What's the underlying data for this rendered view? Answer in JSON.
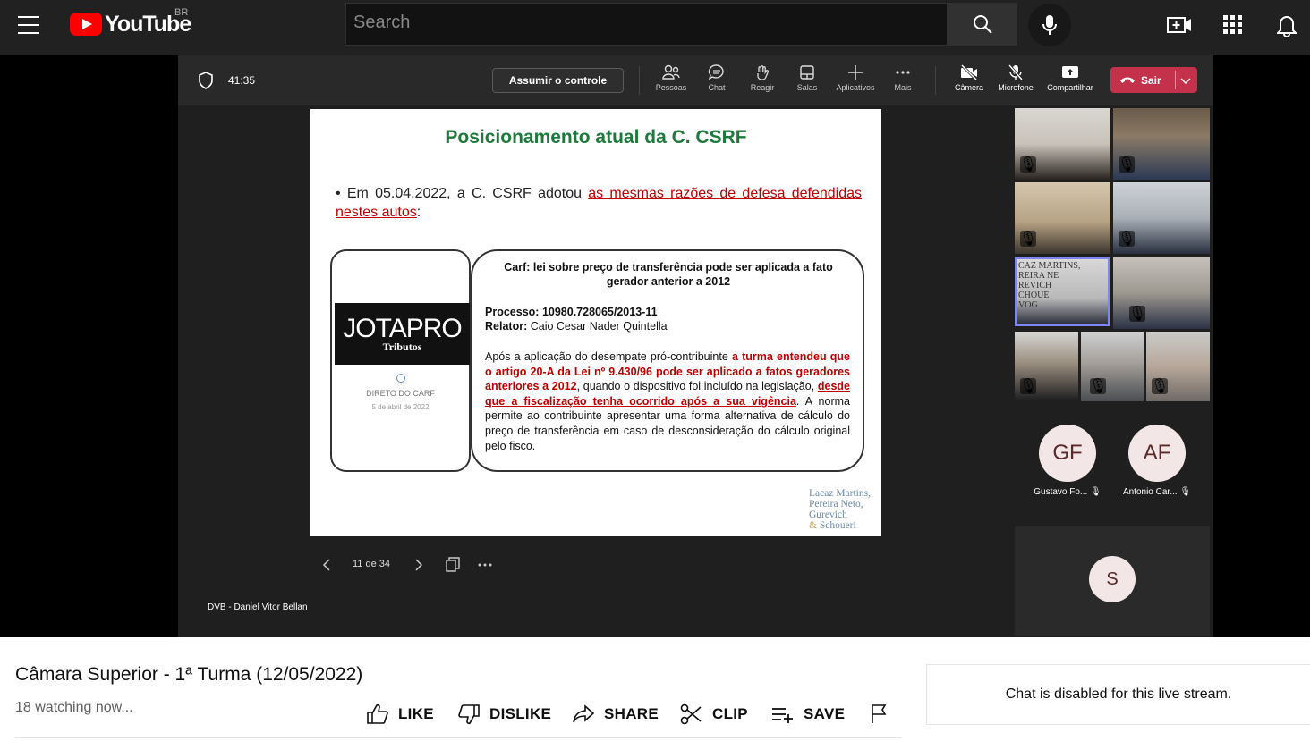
{
  "masthead": {
    "logo_text": "YouTube",
    "country_code": "BR",
    "search_placeholder": "Search",
    "icons": [
      "menu-icon",
      "search-icon",
      "mic-icon",
      "create-icon",
      "apps-icon",
      "notifications-icon"
    ]
  },
  "teams": {
    "timer": "41:35",
    "take_control_label": "Assumir o controle",
    "tools": [
      {
        "label": "Pessoas",
        "icon": "people-icon"
      },
      {
        "label": "Chat",
        "icon": "chat-icon"
      },
      {
        "label": "Reagir",
        "icon": "hand-icon"
      },
      {
        "label": "Salas",
        "icon": "rooms-icon"
      },
      {
        "label": "Aplicativos",
        "icon": "plus-icon"
      },
      {
        "label": "Mais",
        "icon": "more-icon"
      },
      {
        "label": "Câmera",
        "icon": "camera-off-icon"
      },
      {
        "label": "Microfone",
        "icon": "mic-off-icon"
      },
      {
        "label": "Compartilhar",
        "icon": "share-screen-icon"
      }
    ],
    "leave_label": "Sair",
    "presenter": "DVB - Daniel Vitor Bellan",
    "page_indicator": "11 de 34",
    "participants": [
      {
        "initials": "GF",
        "name": "Gustavo Fo..."
      },
      {
        "initials": "AF",
        "name": "Antonio Car..."
      },
      {
        "initials": "S",
        "name": ""
      }
    ],
    "tile_sign_text": [
      "CAZ MARTINS,",
      "REIRA NE",
      "REVICH",
      "CHOUE",
      "VOG"
    ]
  },
  "slide": {
    "title": "Posicionamento atual da C. CSRF",
    "bullet_prefix": "Em 05.04.2022, a C. CSRF adotou ",
    "bullet_highlight": "as mesmas razões de defesa defendidas nestes autos",
    "bullet_suffix": ":",
    "phone": {
      "brand_main": "JOTAPRO",
      "brand_sub": "Tributos",
      "section": "DIRETO DO CARF",
      "date": "5 de abril de 2022"
    },
    "news": {
      "headline": "Carf: lei sobre preço de transferência pode ser aplicada a fato gerador anterior a 2012",
      "processo_label": "Processo:",
      "processo_value": "10980.728065/2013-11",
      "relator_label": "Relator:",
      "relator_value": "Caio Cesar Nader Quintella",
      "body_1": "Após a aplicação do desempate pró-contribuinte ",
      "body_red_1": "a turma entendeu que o artigo 20-A da Lei nº 9.430/96 pode ser aplicado a fatos geradores anteriores a 2012",
      "body_2": ", quando o dispositivo foi incluído na legislação, ",
      "body_red_2": "desde que a fiscalização tenha ocorrido após a sua vigência",
      "body_3": ". A norma permite ao contribuinte apresentar uma forma alternativa de cálculo do preço de transferência em caso de desconsideração do cálculo original pelo fisco."
    },
    "firm_lines": [
      "Lacaz Martins,",
      "Pereira Neto,",
      "Gurevich",
      "Schoueri"
    ],
    "firm_amp": "&"
  },
  "video": {
    "title": "Câmara Superior - 1ª Turma (12/05/2022)",
    "watching": "18 watching now...",
    "actions": {
      "like": "LIKE",
      "dislike": "DISLIKE",
      "share": "SHARE",
      "clip": "CLIP",
      "save": "SAVE"
    },
    "chat_disabled": "Chat is disabled for this live stream."
  }
}
